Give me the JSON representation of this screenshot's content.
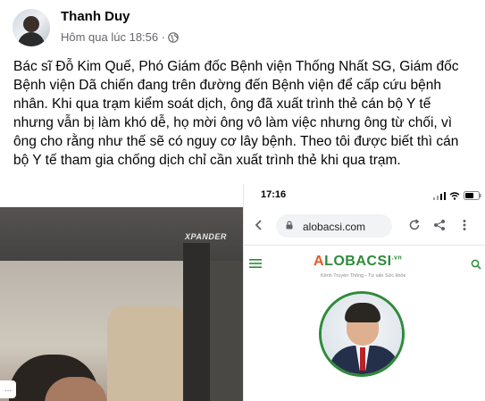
{
  "post": {
    "author": "Thanh Duy",
    "timestamp": "Hôm qua lúc 18:56 ·",
    "privacy_icon": "globe-icon",
    "text": "Bác sĩ Đỗ Kim Quế, Phó Giám đốc Bệnh viện Thống Nhất SG, Giám đốc Bệnh viện Dã chiến đang trên đường đến Bệnh viện để cấp cứu bệnh nhân. Khi qua trạm kiểm soát dịch, ông đã xuất trình thẻ cán bộ Y tế nhưng vẫn bị làm khó dễ, họ mời ông vô làm việc nhưng ông từ chối, vì ông cho rằng như thế sẽ có nguy cơ lây bệnh. Theo tôi được biết thì cán bộ Y tế tham gia chống dịch chỉ cần xuất trình thẻ khi qua trạm."
  },
  "photo_left": {
    "car_badge": "XPANDER",
    "more_label": "..."
  },
  "phone_screenshot": {
    "time": "17:16",
    "url": "alobacsi.com",
    "logo_first": "A",
    "logo_rest": "LOBACSI",
    "logo_suffix": ".vn",
    "tagline": "Kênh Truyền Thông - Tư vấn Sức khỏe",
    "colors": {
      "logo_orange": "#e55a1c",
      "logo_green": "#2e8b3a"
    }
  }
}
